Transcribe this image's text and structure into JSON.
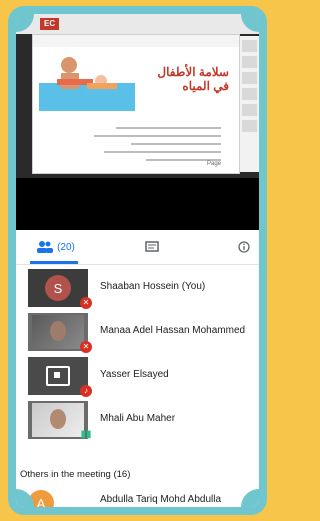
{
  "slide": {
    "tag": "EC",
    "title": "سلامة الأطفال في المياه",
    "footer": "Page"
  },
  "tabs": {
    "people_count": "(20)"
  },
  "participants": [
    {
      "name": "Shaaban Hossein (You)",
      "initial": "S",
      "status": "muted"
    },
    {
      "name": "Manaa Adel Hassan Mohammed",
      "status": "muted"
    },
    {
      "name": "Yasser Elsayed",
      "status": "speaking"
    },
    {
      "name": "Mhali Abu Maher",
      "status": "speaking"
    }
  ],
  "others_header": "Others in the meeting (16)",
  "other_first": {
    "initial": "A",
    "name": "Abdulla Tariq Mohd Abdulla"
  },
  "colors": {
    "frame_yellow": "#f6c54a",
    "frame_teal": "#6fc6ce",
    "accent_blue": "#1a73e8",
    "mute_red": "#d93025"
  }
}
